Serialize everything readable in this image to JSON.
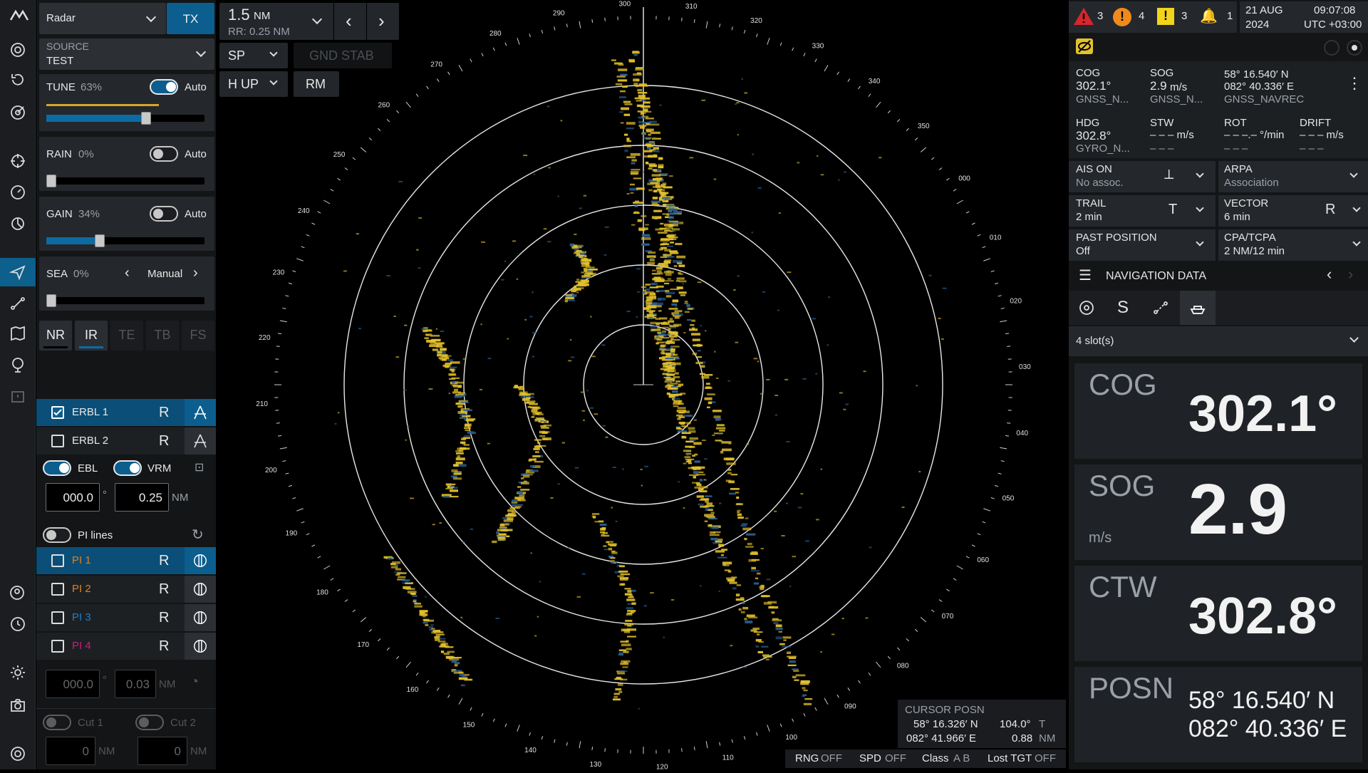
{
  "colors": {
    "accent": "#0b5e8e",
    "echo": "#e3c12b",
    "background": "#000000"
  },
  "rail": {
    "icons": [
      "target-icon",
      "refresh-icon",
      "radar-target-icon",
      "crosshair-icon",
      "gauge-icon",
      "compass-icon",
      "send-icon",
      "route-icon",
      "map-icon",
      "anchor-icon",
      "message-icon",
      "user-icon",
      "history-icon",
      "brightness-icon",
      "camera-icon",
      "settings-icon"
    ],
    "logo": "brand-logo"
  },
  "panel": {
    "mode_select": "Radar",
    "tx_button": "TX",
    "source_label": "SOURCE",
    "source_value": "TEST",
    "tune": {
      "label": "TUNE",
      "value": "63%",
      "auto": "Auto",
      "level": 0.63
    },
    "rain": {
      "label": "RAIN",
      "value": "0%",
      "auto": "Auto",
      "level": 0
    },
    "gain": {
      "label": "GAIN",
      "value": "34%",
      "auto": "Auto",
      "level": 0.34
    },
    "sea": {
      "label": "SEA",
      "value": "0%",
      "mode": "Manual",
      "level": 0
    },
    "filters": [
      "NR",
      "IR",
      "TE",
      "TB",
      "FS"
    ],
    "erbl1": {
      "label": "ERBL 1",
      "ref": "R"
    },
    "erbl2": {
      "label": "ERBL 2",
      "ref": "R"
    },
    "ebl_label": "EBL",
    "vrm_label": "VRM",
    "ebl_value": "000.0",
    "ebl_unit": "°",
    "vrm_value": "0.25",
    "vrm_unit": "NM",
    "pi_lines": "PI lines",
    "pi": [
      {
        "label": "PI 1",
        "ref": "R",
        "color": "#d9822b"
      },
      {
        "label": "PI 2",
        "ref": "R",
        "color": "#d9822b"
      },
      {
        "label": "PI 3",
        "ref": "R",
        "color": "#1f7fc2"
      },
      {
        "label": "PI 4",
        "ref": "R",
        "color": "#c2217e"
      }
    ],
    "pi_bearing": "000.0",
    "pi_bearing_unit": "°",
    "pi_range": "0.03",
    "pi_range_unit": "NM",
    "cut1": {
      "label": "Cut 1",
      "value": "0",
      "unit": "NM"
    },
    "cut2": {
      "label": "Cut 2",
      "value": "0",
      "unit": "NM"
    }
  },
  "top": {
    "range_value": "1.5",
    "range_unit": "NM",
    "rr": "RR: 0.25 NM",
    "sp": "SP",
    "gnd_stab": "GND STAB",
    "h_up": "H UP",
    "rm": "RM"
  },
  "radar": {
    "bearing_labels": [
      "000",
      "010",
      "020",
      "030",
      "040",
      "050",
      "060",
      "070",
      "080",
      "090",
      "100",
      "110",
      "120",
      "130",
      "140",
      "150",
      "160",
      "170",
      "180",
      "190",
      "200",
      "210",
      "220",
      "230",
      "240",
      "250",
      "260",
      "270",
      "280",
      "290",
      "300",
      "310",
      "320",
      "330",
      "340",
      "350"
    ],
    "heading_deg": 302.8,
    "ring_count": 5
  },
  "cursor": {
    "title": "CURSOR POSN",
    "lat": "58° 16.326′ N",
    "lon": "082° 41.966′ E",
    "brg": "104.0°",
    "brg_ref": "T",
    "rng": "0.88",
    "rng_unit": "NM"
  },
  "statusbar": {
    "rng": "RNG",
    "rng_state": "OFF",
    "spd": "SPD",
    "spd_state": "OFF",
    "class": "Class",
    "class_state": "A B",
    "lost": "Lost TGT",
    "lost_state": "OFF"
  },
  "alerts": {
    "alarm": "3",
    "warning": "4",
    "caution": "3",
    "bell": "1",
    "date": "21 AUG",
    "year": "2024",
    "time": "09:07:08",
    "tz": "UTC +03:00"
  },
  "nav": {
    "cog_l": "COG",
    "cog": "302.1°",
    "cog_src": "GNSS_N...",
    "sog_l": "SOG",
    "sog": "2.9",
    "sog_u": "m/s",
    "sog_src": "GNSS_N...",
    "lat": "58° 16.540′ N",
    "lon": "082° 40.336′ E",
    "pos_src": "GNSS_NAVREC",
    "hdg_l": "HDG",
    "hdg": "302.8°",
    "hdg_src": "GYRO_N...",
    "stw_l": "STW",
    "stw": "– – – m/s",
    "stw_src": "– – –",
    "rot_l": "ROT",
    "rot": "– – –.– °/min",
    "rot_src": "– – –",
    "drift_l": "DRIFT",
    "drift": "– – – m/s",
    "drift_src": "– – –"
  },
  "targets": {
    "ais": "AIS ON",
    "ais_sub": "No assoc.",
    "arpa": "ARPA",
    "arpa_sub": "Association",
    "trail": "TRAIL",
    "trail_sub": "2 min",
    "trail_mode": "T",
    "vector": "VECTOR",
    "vector_sub": "6 min",
    "vector_mode": "R",
    "past": "PAST POSITION",
    "past_sub": "Off",
    "cpa": "CPA/TCPA",
    "cpa_sub": "2 NM/12 min"
  },
  "navdata": {
    "title": "NAVIGATION DATA",
    "slots": "4 slot(s)",
    "cog_l": "COG",
    "cog": "302.1°",
    "sog_l": "SOG",
    "sog": "2.9",
    "sog_u": "m/s",
    "ctw_l": "CTW",
    "ctw": "302.8°",
    "posn_l": "POSN",
    "lat": "58° 16.540′ N",
    "lon": "082° 40.336′ E"
  }
}
